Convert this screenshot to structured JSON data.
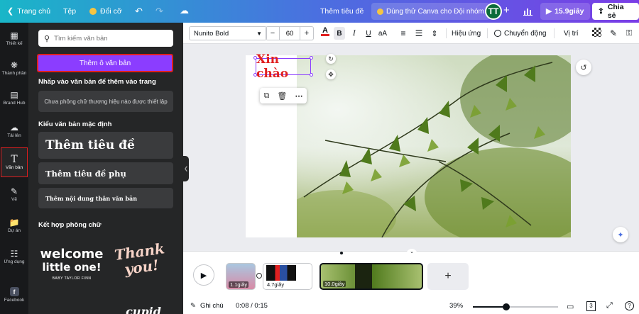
{
  "topbar": {
    "home_label": "Trang chủ",
    "file_label": "Tệp",
    "resize_label": "Đổi cỡ",
    "design_title": "Thêm tiêu đề",
    "try_teams_label": "Dùng thử Canva cho Đội nhóm",
    "avatar_initials": "TT",
    "duration_label": "15.9giây",
    "share_label": "Chia sẻ"
  },
  "rail": {
    "items": [
      {
        "label": "Thiết kế",
        "icon": "layout-icon"
      },
      {
        "label": "Thành phần",
        "icon": "elements-icon"
      },
      {
        "label": "Brand Hub",
        "icon": "brand-icon"
      },
      {
        "label": "Tải lên",
        "icon": "upload-icon"
      },
      {
        "label": "Văn bản",
        "icon": "text-icon"
      },
      {
        "label": "Vẽ",
        "icon": "draw-icon"
      },
      {
        "label": "Dự án",
        "icon": "folder-icon"
      },
      {
        "label": "Ứng dụng",
        "icon": "apps-icon"
      },
      {
        "label": "Facebook",
        "icon": "facebook-icon"
      }
    ]
  },
  "panel": {
    "search_placeholder": "Tìm kiếm văn bản",
    "add_textbox_label": "Thêm ô văn bản",
    "click_hint": "Nhấp vào văn bản để thêm vào trang",
    "brand_note": "Chưa phông chữ thương hiệu nào được thiết lập",
    "default_styles_heading": "Kiểu văn bản mặc định",
    "style_heading": "Thêm tiêu đề",
    "style_subheading": "Thêm tiêu đề phụ",
    "style_body": "Thêm nội dung thân văn bản",
    "font_combos_heading": "Kết hợp phông chữ",
    "combo1_line1": "welcome",
    "combo1_line2": "little one!",
    "combo1_sub": "BABY TAYLOR FINN",
    "combo2_line1": "Thank",
    "combo2_line2": "you!",
    "combo3_partial": "cupid"
  },
  "toolbar": {
    "font_name": "Nunito Bold",
    "font_size": "60",
    "effects_label": "Hiệu ứng",
    "animate_label": "Chuyển động",
    "position_label": "Vị trí"
  },
  "canvas": {
    "text_element": "Xin chào"
  },
  "timeline": {
    "clips": [
      {
        "duration": "1.1giây"
      },
      {
        "duration": "4.7giây"
      },
      {
        "duration": "10.0giây"
      }
    ]
  },
  "footer": {
    "notes_label": "Ghi chú",
    "time_label": "0:08 / 0:15",
    "zoom_label": "39%",
    "zoom_value": 0.39,
    "page_count": "3"
  },
  "colors": {
    "accent_purple": "#8b3dff",
    "highlight_red": "#e02020",
    "rail_bg": "#18191b",
    "panel_bg": "#252627"
  }
}
